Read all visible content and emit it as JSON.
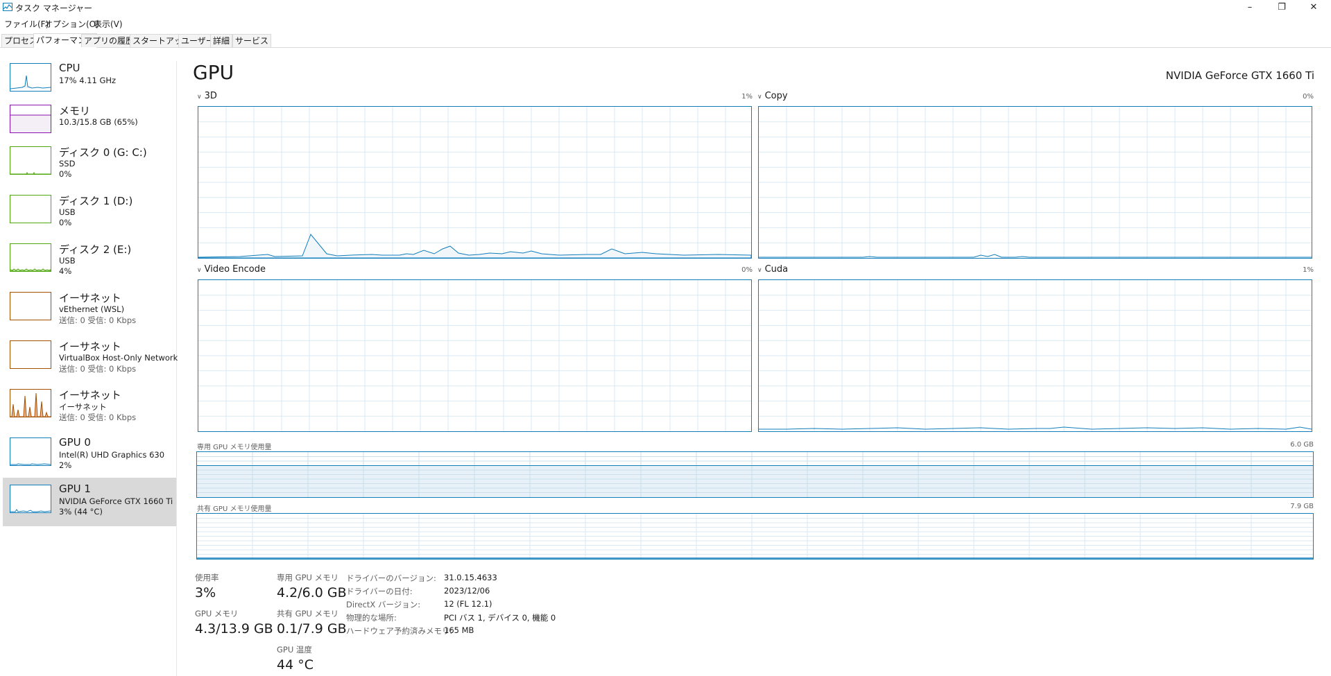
{
  "window": {
    "title": "タスク マネージャー",
    "minimize": "–",
    "restore": "❐",
    "close": "✕"
  },
  "menu": [
    "ファイル(F)",
    "オプション(O)",
    "表示(V)"
  ],
  "tabs": [
    "プロセス",
    "パフォーマンス",
    "アプリの履歴",
    "スタートアップ",
    "ユーザー",
    "詳細",
    "サービス"
  ],
  "active_tab": "パフォーマンス",
  "sidebar": {
    "items": [
      {
        "name": "CPU",
        "sub1": "17% 4.11 GHz",
        "color": "#117dbb"
      },
      {
        "name": "メモリ",
        "sub1": "10.3/15.8 GB (65%)",
        "color": "#8b12ae"
      },
      {
        "name": "ディスク 0 (G: C:)",
        "sub1": "SSD",
        "sub2": "0%",
        "color": "#4da60c"
      },
      {
        "name": "ディスク 1 (D:)",
        "sub1": "USB",
        "sub2": "0%",
        "color": "#4da60c"
      },
      {
        "name": "ディスク 2 (E:)",
        "sub1": "USB",
        "sub2": "4%",
        "color": "#4da60c"
      },
      {
        "name": "イーサネット",
        "sub1": "vEthernet (WSL)",
        "sub2": "送信: 0 受信: 0 Kbps",
        "color": "#a74f01"
      },
      {
        "name": "イーサネット",
        "sub1": "VirtualBox Host-Only Network",
        "sub2": "送信: 0 受信: 0 Kbps",
        "color": "#a74f01"
      },
      {
        "name": "イーサネット",
        "sub1": "イーサネット",
        "sub2": "送信: 0 受信: 0 Kbps",
        "color": "#a74f01"
      },
      {
        "name": "GPU 0",
        "sub1": "Intel(R) UHD Graphics 630",
        "sub2": "2%",
        "color": "#117dbb"
      },
      {
        "name": "GPU 1",
        "sub1": "NVIDIA GeForce GTX 1660 Ti",
        "sub2": "3% (44 °C)",
        "color": "#117dbb"
      }
    ],
    "selected_index": 9
  },
  "main": {
    "title": "GPU",
    "model": "NVIDIA GeForce GTX 1660 Ti",
    "engines": [
      {
        "name": "3D",
        "pct": "1%"
      },
      {
        "name": "Copy",
        "pct": "0%"
      },
      {
        "name": "Video Encode",
        "pct": "0%"
      },
      {
        "name": "Cuda",
        "pct": "1%"
      }
    ],
    "dedicated_mem_label": "専用 GPU メモリ使用量",
    "dedicated_mem_max": "6.0 GB",
    "dedicated_mem_usage_fraction": 0.7,
    "shared_mem_label": "共有 GPU メモリ使用量",
    "shared_mem_max": "7.9 GB",
    "shared_mem_usage_fraction": 0.013
  },
  "stats": {
    "usage_label": "使用率",
    "usage_value": "3%",
    "gpu_mem_label": "GPU メモリ",
    "gpu_mem_value": "4.3/13.9 GB",
    "ded_label": "専用 GPU メモリ",
    "ded_value": "4.2/6.0 GB",
    "shared_label": "共有 GPU メモリ",
    "shared_value": "0.1/7.9 GB",
    "temp_label": "GPU 温度",
    "temp_value": "44 °C"
  },
  "info": [
    {
      "label": "ドライバーのバージョン:",
      "value": "31.0.15.4633"
    },
    {
      "label": "ドライバーの日付:",
      "value": "2023/12/06"
    },
    {
      "label": "DirectX バージョン:",
      "value": "12 (FL 12.1)"
    },
    {
      "label": "物理的な場所:",
      "value": "PCI バス 1, デバイス 0, 機能 0"
    },
    {
      "label": "ハードウェア予約済みメモリ:",
      "value": "165 MB"
    }
  ],
  "colors": {
    "accent": "#117dbb",
    "selected_bg": "#d9d9d9"
  }
}
